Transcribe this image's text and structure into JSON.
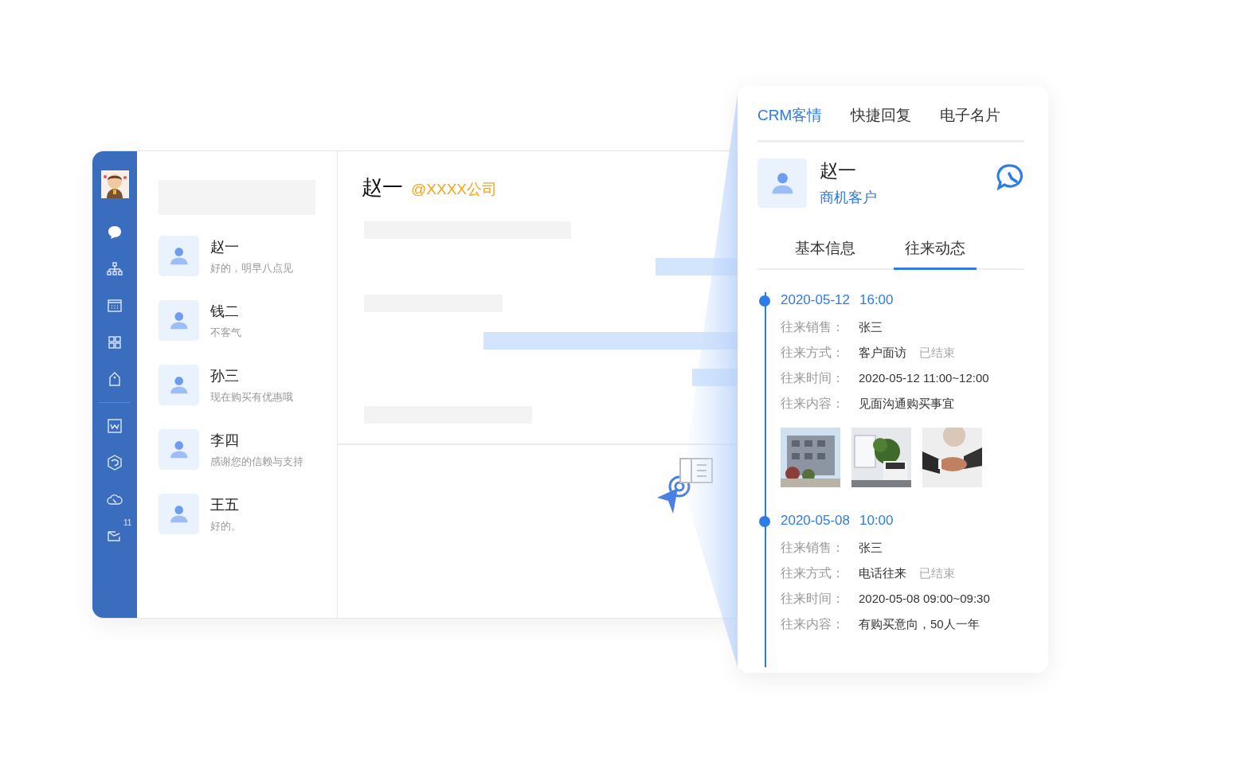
{
  "sidebar": {
    "mail_badge": "11"
  },
  "contacts": [
    {
      "name": "赵一",
      "preview": "好的，明早八点见"
    },
    {
      "name": "钱二",
      "preview": "不客气"
    },
    {
      "name": "孙三",
      "preview": "现在购买有优惠哦"
    },
    {
      "name": "李四",
      "preview": "感谢您的信赖与支持"
    },
    {
      "name": "王五",
      "preview": "好的。"
    }
  ],
  "chat": {
    "name": "赵一",
    "company": "@XXXX公司"
  },
  "panel": {
    "tabs": [
      {
        "label": "CRM客情",
        "selected": true
      },
      {
        "label": "快捷回复",
        "selected": false
      },
      {
        "label": "电子名片",
        "selected": false
      }
    ],
    "customer": {
      "name": "赵一",
      "type": "商机客户"
    },
    "subtabs": [
      {
        "label": "基本信息",
        "selected": false
      },
      {
        "label": "往来动态",
        "selected": true
      }
    ],
    "timeline": [
      {
        "date": "2020-05-12",
        "time": "16:00",
        "fields": [
          {
            "label": "往来销售：",
            "value": "张三"
          },
          {
            "label": "往来方式：",
            "value": "客户面访",
            "status": "已结束"
          },
          {
            "label": "往来时间：",
            "value": "2020-05-12 11:00~12:00"
          },
          {
            "label": "往来内容：",
            "value": "见面沟通购买事宜"
          }
        ],
        "photos": [
          {
            "kind": "picture"
          },
          {
            "kind": "picture"
          },
          {
            "kind": "picture"
          }
        ]
      },
      {
        "date": "2020-05-08",
        "time": "10:00",
        "fields": [
          {
            "label": "往来销售：",
            "value": "张三"
          },
          {
            "label": "往来方式：",
            "value": "电话往来",
            "status": "已结束"
          },
          {
            "label": "往来时间：",
            "value": "2020-05-08 09:00~09:30"
          },
          {
            "label": "往来内容：",
            "value": "有购买意向，50人一年"
          }
        ]
      }
    ]
  }
}
